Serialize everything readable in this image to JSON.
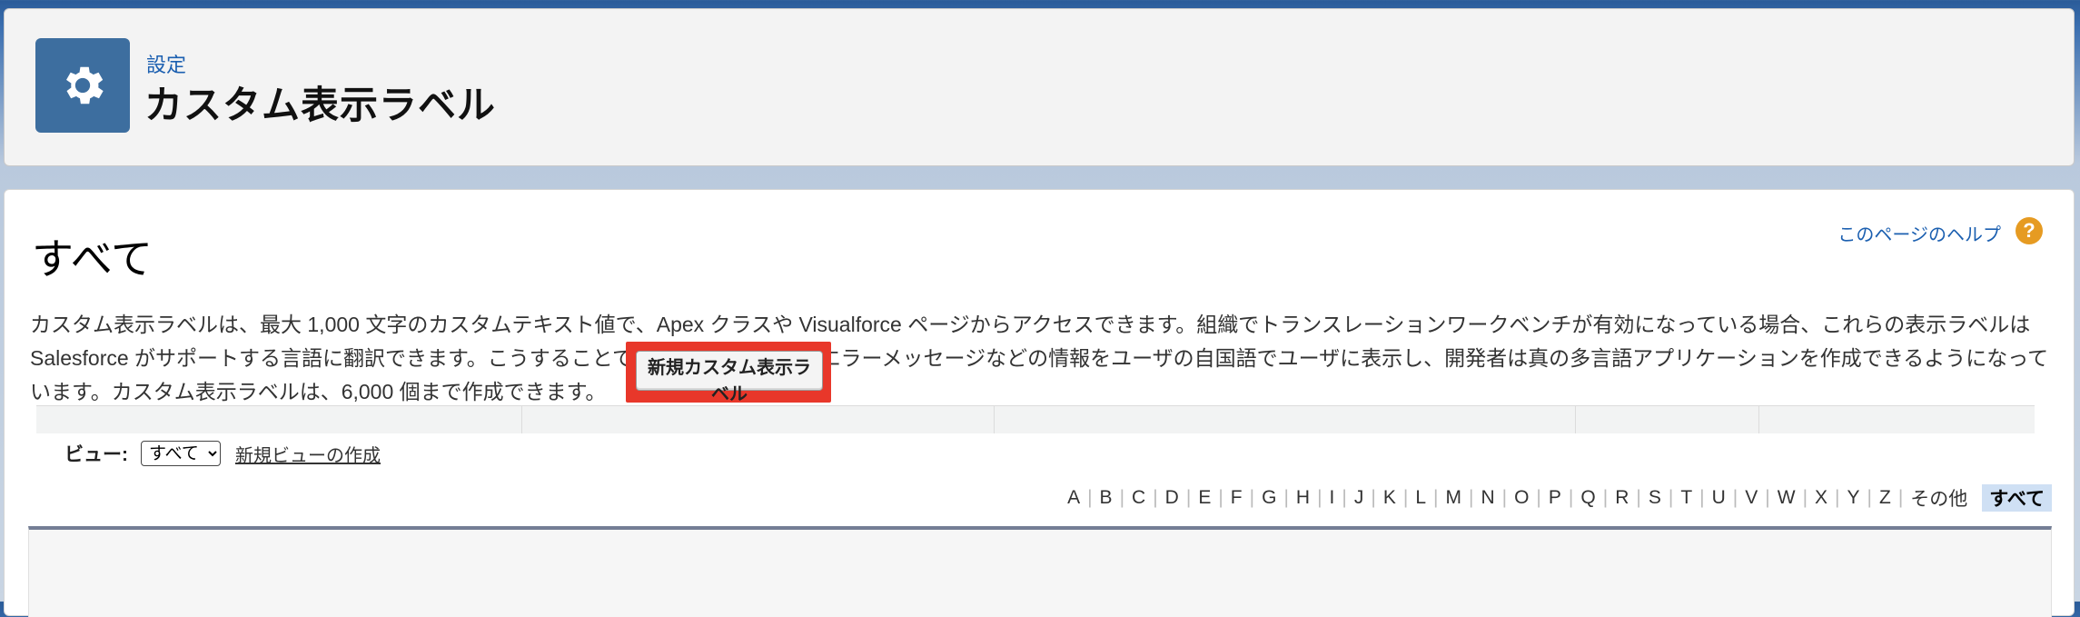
{
  "header": {
    "breadcrumb": "設定",
    "title": "カスタム表示ラベル",
    "icon": "gear-icon"
  },
  "content": {
    "section_title": "すべて",
    "help_link": "このページのヘルプ",
    "help_icon_glyph": "?",
    "description": "カスタム表示ラベルは、最大 1,000 文字のカスタムテキスト値で、Apex クラスや Visualforce ページからアクセスできます。組織でトランスレーションワークベンチが有効になっている場合、これらの表示ラベルは Salesforce がサポートする言語に翻訳できます。こうすることで、ヘルプテキストやエラーメッセージなどの情報をユーザの自国語でユーザに表示し、開発者は真の多言語アプリケーションを作成できるようになっています。カスタム表示ラベルは、6,000 個まで作成できます。",
    "view": {
      "label": "ビュー:",
      "selected": "すべて",
      "create_link": "新規ビューの作成"
    },
    "alpha_filter": [
      "A",
      "B",
      "C",
      "D",
      "E",
      "F",
      "G",
      "H",
      "I",
      "J",
      "K",
      "L",
      "M",
      "N",
      "O",
      "P",
      "Q",
      "R",
      "S",
      "T",
      "U",
      "V",
      "W",
      "X",
      "Y",
      "Z",
      "その他"
    ],
    "alpha_current": "すべて",
    "new_button": "新規カスタム表示ラベル"
  },
  "colors": {
    "highlight": "#e8372a",
    "icon_bg": "#3d6e9f",
    "link": "#1b5fb0"
  }
}
